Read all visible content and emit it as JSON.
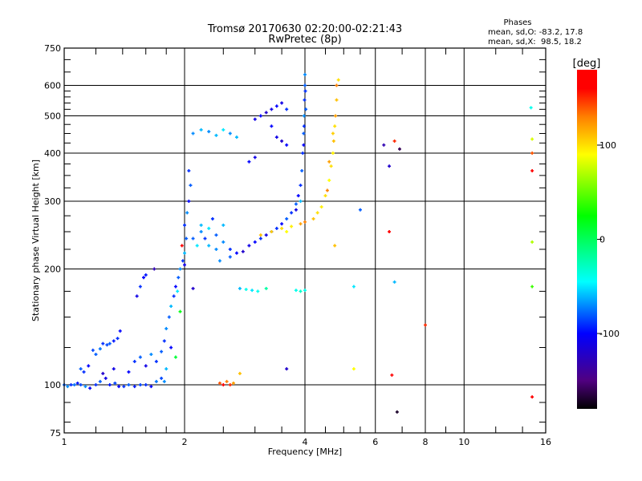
{
  "chart_data": {
    "type": "scatter",
    "title": "Tromsø 20170630 02:20:00-02:21:43",
    "subtitle": "RwPretec (8p)",
    "xlabel": "Frequency [MHz]",
    "ylabel": "Stationary phase Virtual Height [km]",
    "xscale": "log",
    "yscale": "log",
    "xlim": [
      1,
      16
    ],
    "ylim": [
      75,
      750
    ],
    "xticks": [
      1,
      2,
      4,
      6,
      8,
      10,
      16
    ],
    "xtick_labels": [
      "1",
      "2",
      "4",
      "6",
      "8",
      "10",
      "16"
    ],
    "yticks": [
      75,
      100,
      200,
      300,
      400,
      500,
      600,
      750
    ],
    "ytick_labels": [
      "75",
      "100",
      "200",
      "300",
      "400",
      "500",
      "600",
      "750"
    ],
    "grid": {
      "x": [
        2,
        4,
        6,
        8,
        10
      ],
      "y": [
        100,
        200,
        300,
        400,
        500,
        600
      ]
    },
    "stats": {
      "heading": "Phases",
      "o_line": "mean, sd,O: -83.2, 17.8",
      "x_line": "mean, sd,X:  98.5, 18.2"
    },
    "colorbar": {
      "label": "[deg]",
      "range": [
        -180,
        180
      ],
      "ticks": [
        100,
        0,
        -100
      ],
      "tick_labels": [
        "100",
        "0",
        "-100"
      ],
      "stops": [
        {
          "v": -180,
          "c": "#000000"
        },
        {
          "v": -150,
          "c": "#500080"
        },
        {
          "v": -100,
          "c": "#0000ff"
        },
        {
          "v": -45,
          "c": "#00ffff"
        },
        {
          "v": 25,
          "c": "#00ff00"
        },
        {
          "v": 90,
          "c": "#ffff00"
        },
        {
          "v": 130,
          "c": "#ff8000"
        },
        {
          "v": 160,
          "c": "#ff0000"
        },
        {
          "v": 180,
          "c": "#ff0000"
        }
      ]
    },
    "points_columns": [
      "frequency_MHz",
      "height_km",
      "phase_deg"
    ],
    "points": [
      [
        1.0,
        100,
        -80
      ],
      [
        1.02,
        99,
        -70
      ],
      [
        1.04,
        100,
        -90
      ],
      [
        1.06,
        100,
        -75
      ],
      [
        1.08,
        101,
        -95
      ],
      [
        1.1,
        100,
        -85
      ],
      [
        1.13,
        99,
        -70
      ],
      [
        1.16,
        98,
        -100
      ],
      [
        1.2,
        100,
        -90
      ],
      [
        1.23,
        102,
        -80
      ],
      [
        1.27,
        104,
        -110
      ],
      [
        1.3,
        100,
        -95
      ],
      [
        1.34,
        101,
        -85
      ],
      [
        1.37,
        99,
        -100
      ],
      [
        1.41,
        99,
        -90
      ],
      [
        1.45,
        100,
        -80
      ],
      [
        1.5,
        99,
        -95
      ],
      [
        1.55,
        100,
        -85
      ],
      [
        1.6,
        100,
        -90
      ],
      [
        1.65,
        99,
        -100
      ],
      [
        1.7,
        102,
        -75
      ],
      [
        1.75,
        104,
        -85
      ],
      [
        1.78,
        102,
        -70
      ],
      [
        1.1,
        110,
        -80
      ],
      [
        1.12,
        108,
        -90
      ],
      [
        1.15,
        112,
        -100
      ],
      [
        1.18,
        123,
        -85
      ],
      [
        1.2,
        120,
        -80
      ],
      [
        1.23,
        124,
        -75
      ],
      [
        1.25,
        128,
        -90
      ],
      [
        1.28,
        127,
        -85
      ],
      [
        1.3,
        128,
        -80
      ],
      [
        1.33,
        130,
        -95
      ],
      [
        1.36,
        132,
        -90
      ],
      [
        1.38,
        138,
        -100
      ],
      [
        1.25,
        107,
        -120
      ],
      [
        1.33,
        110,
        -110
      ],
      [
        1.45,
        108,
        -100
      ],
      [
        1.5,
        115,
        -90
      ],
      [
        1.55,
        118,
        -80
      ],
      [
        1.6,
        112,
        -110
      ],
      [
        1.65,
        120,
        -70
      ],
      [
        1.7,
        115,
        -90
      ],
      [
        1.75,
        122,
        -80
      ],
      [
        1.8,
        110,
        -60
      ],
      [
        1.85,
        125,
        -100
      ],
      [
        1.9,
        118,
        10
      ],
      [
        1.52,
        170,
        -110
      ],
      [
        1.55,
        180,
        -90
      ],
      [
        1.58,
        190,
        -100
      ],
      [
        1.6,
        193,
        -95
      ],
      [
        1.68,
        200,
        -130
      ],
      [
        1.78,
        130,
        -90
      ],
      [
        1.8,
        140,
        -70
      ],
      [
        1.83,
        150,
        -80
      ],
      [
        1.85,
        160,
        -60
      ],
      [
        1.88,
        170,
        -90
      ],
      [
        1.9,
        180,
        -100
      ],
      [
        1.93,
        190,
        -80
      ],
      [
        1.95,
        200,
        -70
      ],
      [
        1.98,
        210,
        -90
      ],
      [
        2.0,
        220,
        -60
      ],
      [
        2.02,
        240,
        -80
      ],
      [
        2.0,
        260,
        -90
      ],
      [
        2.03,
        280,
        -70
      ],
      [
        2.05,
        300,
        -100
      ],
      [
        2.07,
        330,
        -80
      ],
      [
        2.05,
        360,
        -90
      ],
      [
        1.97,
        230,
        160
      ],
      [
        1.92,
        175,
        -50
      ],
      [
        1.95,
        155,
        20
      ],
      [
        2.0,
        205,
        -110
      ],
      [
        2.1,
        240,
        -80
      ],
      [
        2.2,
        250,
        -70
      ],
      [
        2.25,
        240,
        -90
      ],
      [
        2.3,
        230,
        -60
      ],
      [
        2.4,
        245,
        -80
      ],
      [
        2.5,
        235,
        -70
      ],
      [
        2.6,
        225,
        -90
      ],
      [
        2.7,
        220,
        -100
      ],
      [
        2.8,
        222,
        -120
      ],
      [
        2.9,
        230,
        -110
      ],
      [
        3.0,
        235,
        -100
      ],
      [
        3.1,
        240,
        -90
      ],
      [
        3.2,
        245,
        -110
      ],
      [
        3.3,
        250,
        -100
      ],
      [
        3.4,
        255,
        -90
      ],
      [
        3.5,
        262,
        -100
      ],
      [
        3.6,
        270,
        -80
      ],
      [
        3.7,
        280,
        -90
      ],
      [
        3.8,
        295,
        -80
      ],
      [
        3.85,
        310,
        -100
      ],
      [
        3.9,
        330,
        -90
      ],
      [
        3.93,
        360,
        -80
      ],
      [
        3.95,
        400,
        -90
      ],
      [
        3.97,
        450,
        -80
      ],
      [
        3.98,
        500,
        -70
      ],
      [
        3.99,
        550,
        -90
      ],
      [
        4.0,
        600,
        -80
      ],
      [
        4.0,
        640,
        -70
      ],
      [
        3.97,
        420,
        -100
      ],
      [
        3.98,
        470,
        -90
      ],
      [
        4.02,
        520,
        -80
      ],
      [
        4.01,
        580,
        -90
      ],
      [
        3.9,
        300,
        -60
      ],
      [
        3.8,
        285,
        -110
      ],
      [
        2.2,
        260,
        -60
      ],
      [
        2.3,
        255,
        -50
      ],
      [
        2.4,
        225,
        -70
      ],
      [
        2.5,
        260,
        -60
      ],
      [
        2.6,
        215,
        -80
      ],
      [
        2.35,
        270,
        -90
      ],
      [
        2.15,
        230,
        -50
      ],
      [
        2.45,
        210,
        -70
      ],
      [
        3.1,
        245,
        110
      ],
      [
        3.3,
        250,
        105
      ],
      [
        3.5,
        255,
        100
      ],
      [
        3.7,
        258,
        95
      ],
      [
        3.9,
        262,
        120
      ],
      [
        4.0,
        265,
        130
      ],
      [
        4.2,
        270,
        110
      ],
      [
        4.3,
        280,
        100
      ],
      [
        4.4,
        290,
        95
      ],
      [
        4.5,
        310,
        100
      ],
      [
        4.6,
        340,
        90
      ],
      [
        4.65,
        370,
        100
      ],
      [
        4.7,
        400,
        95
      ],
      [
        4.72,
        430,
        110
      ],
      [
        4.75,
        470,
        100
      ],
      [
        4.77,
        500,
        120
      ],
      [
        4.8,
        550,
        110
      ],
      [
        4.8,
        600,
        130
      ],
      [
        4.85,
        620,
        100
      ],
      [
        4.7,
        450,
        105
      ],
      [
        4.6,
        380,
        120
      ],
      [
        4.55,
        320,
        130
      ],
      [
        3.6,
        250,
        90
      ],
      [
        2.1,
        450,
        -70
      ],
      [
        2.2,
        460,
        -60
      ],
      [
        2.3,
        455,
        -70
      ],
      [
        2.4,
        445,
        -60
      ],
      [
        2.5,
        460,
        -50
      ],
      [
        2.6,
        450,
        -70
      ],
      [
        2.7,
        440,
        -60
      ],
      [
        3.0,
        490,
        -110
      ],
      [
        3.1,
        500,
        -100
      ],
      [
        3.2,
        510,
        -120
      ],
      [
        3.3,
        520,
        -110
      ],
      [
        3.4,
        530,
        -100
      ],
      [
        3.5,
        540,
        -110
      ],
      [
        3.6,
        520,
        -90
      ],
      [
        3.3,
        470,
        -100
      ],
      [
        3.4,
        440,
        -110
      ],
      [
        3.5,
        430,
        -120
      ],
      [
        3.6,
        420,
        -100
      ],
      [
        3.0,
        390,
        -110
      ],
      [
        2.9,
        380,
        -100
      ],
      [
        2.45,
        101,
        140
      ],
      [
        2.5,
        100,
        160
      ],
      [
        2.55,
        102,
        130
      ],
      [
        2.6,
        100,
        150
      ],
      [
        2.65,
        101,
        120
      ],
      [
        2.75,
        107,
        110
      ],
      [
        2.75,
        178,
        -60
      ],
      [
        2.85,
        177,
        -40
      ],
      [
        2.95,
        176,
        -50
      ],
      [
        3.05,
        175,
        -40
      ],
      [
        3.2,
        178,
        -20
      ],
      [
        3.8,
        176,
        -40
      ],
      [
        3.9,
        175,
        -30
      ],
      [
        4.0,
        176,
        -40
      ],
      [
        2.1,
        178,
        -120
      ],
      [
        6.3,
        420,
        -130
      ],
      [
        6.5,
        370,
        -120
      ],
      [
        6.7,
        430,
        150
      ],
      [
        6.9,
        410,
        -160
      ],
      [
        6.5,
        250,
        170
      ],
      [
        8.0,
        143,
        150
      ],
      [
        6.6,
        106,
        170
      ],
      [
        6.8,
        85,
        -170
      ],
      [
        5.5,
        285,
        -80
      ],
      [
        5.3,
        180,
        -50
      ],
      [
        14.7,
        525,
        -40
      ],
      [
        14.8,
        435,
        80
      ],
      [
        14.8,
        400,
        140
      ],
      [
        14.8,
        360,
        170
      ],
      [
        14.8,
        235,
        70
      ],
      [
        14.8,
        180,
        40
      ],
      [
        14.8,
        93,
        170
      ],
      [
        4.75,
        230,
        110
      ],
      [
        3.6,
        110,
        -120
      ],
      [
        5.3,
        110,
        90
      ],
      [
        6.7,
        185,
        -60
      ]
    ]
  }
}
